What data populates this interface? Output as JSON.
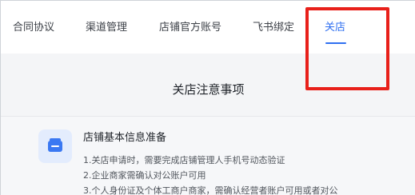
{
  "tabs": {
    "items": [
      {
        "label": "合同协议"
      },
      {
        "label": "渠道管理"
      },
      {
        "label": "店铺官方账号"
      },
      {
        "label": "飞书绑定"
      },
      {
        "label": "关店"
      }
    ],
    "active_index": 4
  },
  "notice": {
    "title": "关店注意事项"
  },
  "card": {
    "icon": "store-icon",
    "title": "店铺基本信息准备",
    "lines": [
      "1.关店申请时，需要完成店铺管理人手机号动态验证",
      "2.企业商家需确认对公账户可用",
      "3.个人身份证及个体工商户商家，需确认经营者账户可用或者对公"
    ]
  },
  "colors": {
    "accent": "#2f6ff0",
    "highlight": "#e8201a",
    "content_bg": "#f4f5f7"
  }
}
